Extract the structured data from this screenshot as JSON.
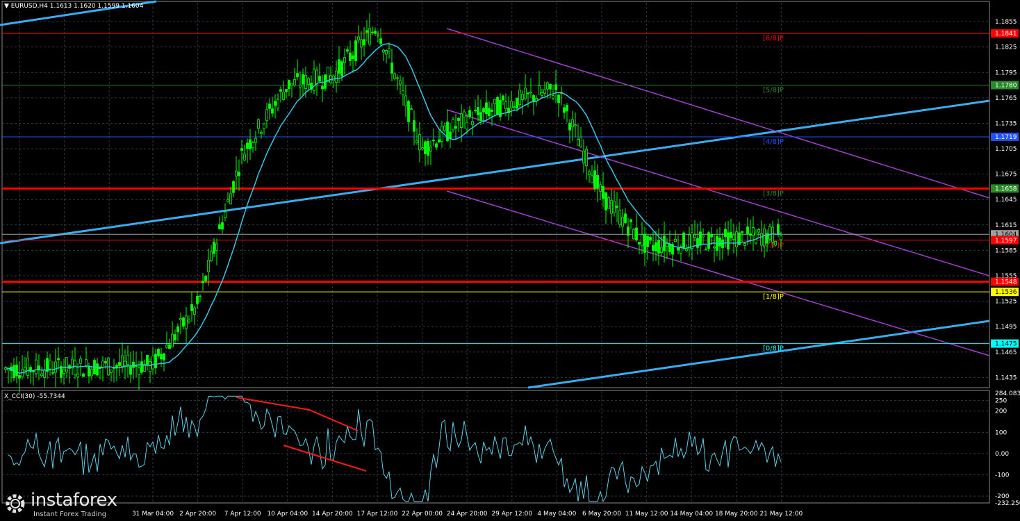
{
  "header": {
    "symbol_label": "EURUSD,H4",
    "ohlc": "1.1613 1.1620 1.1599 1.1604"
  },
  "indicator": {
    "label": "X_CCI(30) -55.7344"
  },
  "branding": {
    "logo_text": "instaforex",
    "tagline": "Instant Forex Trading"
  },
  "colors": {
    "background": "#000000",
    "grid": "#2f3a40",
    "bull_candle": "#00ff00",
    "moving_average": "#33c8e6",
    "trendline": "#38aef0",
    "channel": "#a040d0",
    "murrey_red": "#ff0000",
    "cci_line": "#5fd0e8",
    "divergence": "#ff1a1a"
  },
  "chart_data": [
    {
      "type": "candlestick",
      "title": "EURUSD,H4",
      "y_ticks": [
        "1.1855",
        "1.1825",
        "1.1795",
        "1.1765",
        "1.1735",
        "1.1705",
        "1.1675",
        "1.1645",
        "1.1615",
        "1.1585",
        "1.1555",
        "1.1525",
        "1.1495",
        "1.1465",
        "1.1435"
      ],
      "ylim": [
        1.1423,
        1.1869
      ],
      "x_labels": [
        "31 Mar 04:00",
        "2 Apr 20:00",
        "7 Apr 12:00",
        "10 Apr 04:00",
        "14 Apr 20:00",
        "17 Apr 12:00",
        "22 Apr 00:00",
        "24 Apr 20:00",
        "29 Apr 12:00",
        "4 May 04:00",
        "6 May 20:00",
        "11 May 12:00",
        "14 May 04:00",
        "18 May 20:00",
        "21 May 12:00"
      ],
      "levels": [
        {
          "value": 1.1841,
          "label": "1.1841",
          "murrey": "[6/8]P",
          "color": "#ff0000"
        },
        {
          "value": 1.178,
          "label": "1.1780",
          "murrey": "[5/8]P",
          "color": "#2a8a2a"
        },
        {
          "value": 1.1719,
          "label": "1.1719",
          "murrey": "[4/8]P",
          "color": "#2050ff"
        },
        {
          "value": 1.1658,
          "label": "1.1658",
          "murrey": "[3/8]P",
          "color": "#2a8a2a"
        },
        {
          "value": 1.1604,
          "label": "1.1604",
          "murrey": "",
          "color": "#a0a0a0"
        },
        {
          "value": 1.1597,
          "label": "1.1597",
          "murrey": "[2/8]P",
          "color": "#ff0000"
        },
        {
          "value": 1.1548,
          "label": "1.1548",
          "murrey": "",
          "color": "#ff0000"
        },
        {
          "value": 1.1536,
          "label": "1.1536",
          "murrey": "[1/8]P",
          "color": "#ffff00"
        },
        {
          "value": 1.1475,
          "label": "1.1475",
          "murrey": "[0/8]P",
          "color": "#00ffff"
        }
      ],
      "key_points": [
        {
          "x": "start",
          "y": 1.1445
        },
        {
          "x": "31 Mar 04:00",
          "y": 1.145
        },
        {
          "x": "2 Apr 20:00",
          "y": 1.152
        },
        {
          "x": "7 Apr 12:00",
          "y": 1.17
        },
        {
          "x": "10 Apr 04:00",
          "y": 1.178
        },
        {
          "x": "14 Apr 20:00",
          "y": 1.179
        },
        {
          "x": "17 Apr 12:00",
          "y": 1.185
        },
        {
          "x": "22 Apr 00:00",
          "y": 1.1705
        },
        {
          "x": "29 Apr 12:00",
          "y": 1.174
        },
        {
          "x": "6 May 20:00",
          "y": 1.176
        },
        {
          "x": "11 May 12:00",
          "y": 1.1775
        },
        {
          "x": "14 May 04:00",
          "y": 1.165
        },
        {
          "x": "18 May 20:00",
          "y": 1.159
        },
        {
          "x": "21 May 12:00",
          "y": 1.1604
        }
      ]
    },
    {
      "type": "line",
      "title": "X_CCI(30) -55.7344",
      "y_ticks": [
        "284.0839",
        "250",
        "200",
        "100",
        "0.00",
        "-100",
        "-200",
        "-232.256"
      ],
      "ylim": [
        -232.256,
        284.0839
      ],
      "current_value": -55.7344
    }
  ]
}
